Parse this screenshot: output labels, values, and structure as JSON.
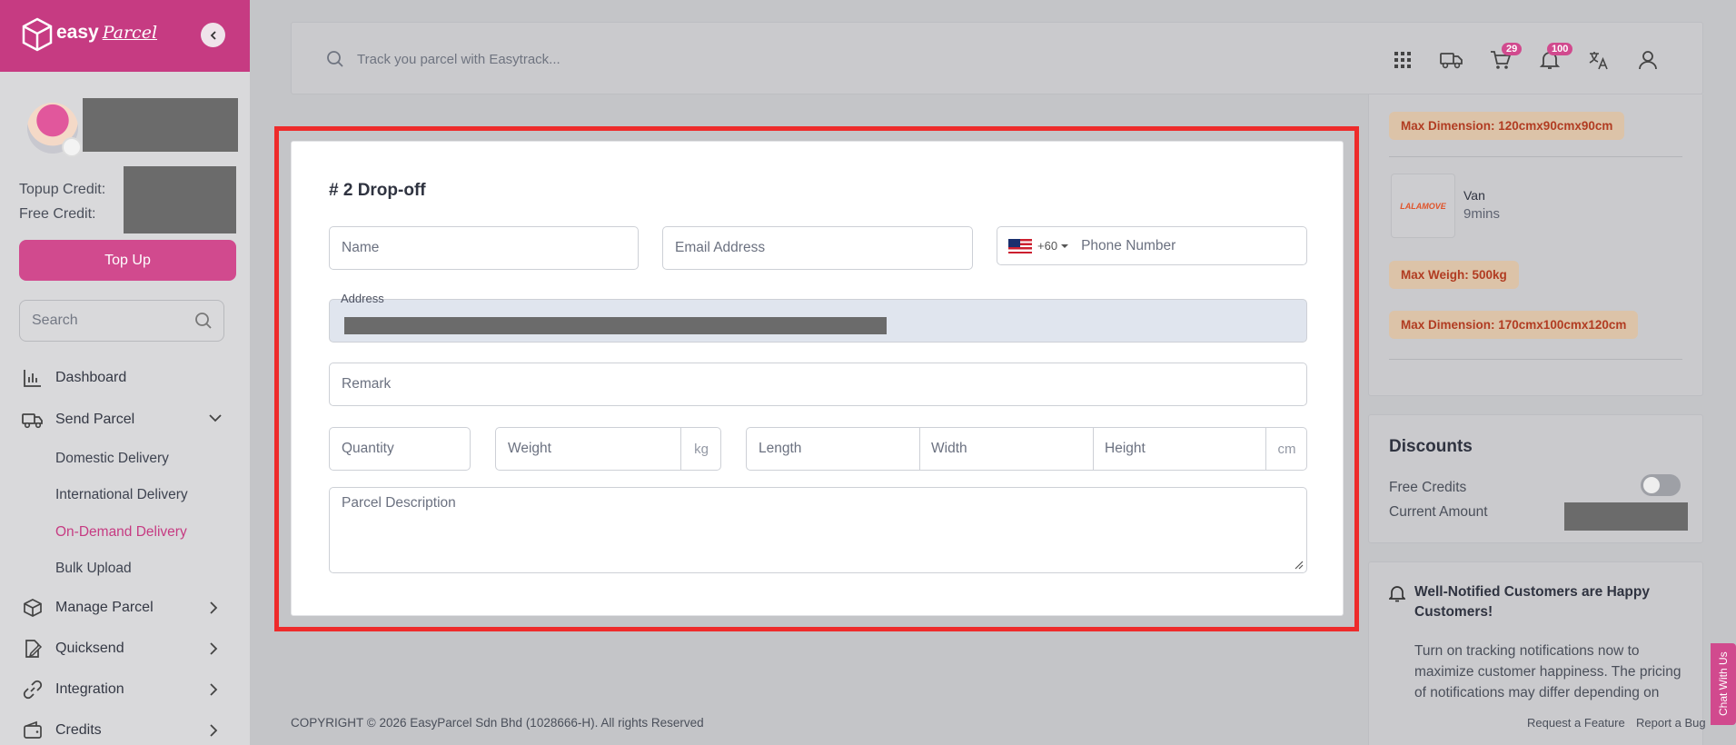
{
  "brand": {
    "name": "easy",
    "name_script": "Parcel",
    "collapse_icon": "chevron-left-icon"
  },
  "user": {
    "topup_label": "Topup Credit:",
    "free_label": "Free Credit:",
    "topup_button": "Top Up"
  },
  "sidebar": {
    "search_placeholder": "Search",
    "items": [
      {
        "label": "Dashboard",
        "icon": "chart-bar-icon"
      },
      {
        "label": "Send Parcel",
        "icon": "truck-icon",
        "expanded": true
      },
      {
        "label": "Manage Parcel",
        "icon": "box-icon"
      },
      {
        "label": "Quicksend",
        "icon": "edit-icon"
      },
      {
        "label": "Integration",
        "icon": "link-icon"
      },
      {
        "label": "Credits",
        "icon": "wallet-icon"
      }
    ],
    "sub_items": [
      {
        "label": "Domestic Delivery"
      },
      {
        "label": "International Delivery"
      },
      {
        "label": "On-Demand Delivery",
        "active": true
      },
      {
        "label": "Bulk Upload"
      }
    ]
  },
  "topbar": {
    "search_placeholder": "Track you parcel with Easytrack...",
    "cart_count": "29",
    "notif_count": "100"
  },
  "form": {
    "title": "# 2 Drop-off",
    "name_placeholder": "Name",
    "email_placeholder": "Email Address",
    "phone_code": "+60",
    "phone_placeholder": "Phone Number",
    "address_label": "Address",
    "remark_placeholder": "Remark",
    "quantity_placeholder": "Quantity",
    "weight_placeholder": "Weight",
    "weight_unit": "kg",
    "length_placeholder": "Length",
    "width_placeholder": "Width",
    "height_placeholder": "Height",
    "dimension_unit": "cm",
    "description_placeholder": "Parcel Description"
  },
  "vehicles": {
    "prev_max_dimension": "Max Dimension: 120cmx90cmx90cm",
    "van_name": "Van",
    "van_time": "9mins",
    "van_logo": "LALAMOVE",
    "van_max_weight": "Max Weigh: 500kg",
    "van_max_dimension": "Max Dimension: 170cmx100cmx120cm"
  },
  "discounts": {
    "title": "Discounts",
    "free_credits_label": "Free Credits",
    "current_amount_label": "Current Amount"
  },
  "notice": {
    "title": "Well-Notified Customers are Happy Customers!",
    "body": "Turn on tracking notifications now to maximize customer happiness. The pricing of notifications may differ depending on"
  },
  "footer": {
    "copyright": "COPYRIGHT © 2026 EasyParcel Sdn Bhd (1028666-H). All rights Reserved",
    "request_feature": "Request a Feature",
    "report_bug": "Report a Bug",
    "chat": "Chat With Us"
  },
  "colors": {
    "brand": "#c63b82",
    "highlight": "#ee2b2b"
  }
}
